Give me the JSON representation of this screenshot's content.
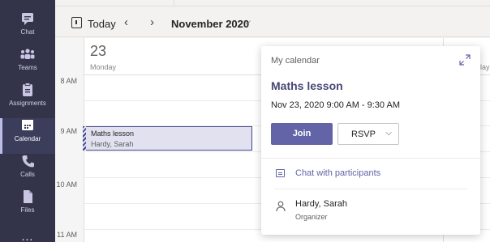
{
  "rail": {
    "items": [
      {
        "label": "Chat",
        "icon": "chat-icon"
      },
      {
        "label": "Teams",
        "icon": "teams-icon"
      },
      {
        "label": "Assignments",
        "icon": "assignments-icon"
      },
      {
        "label": "Calendar",
        "icon": "calendar-icon",
        "active": true
      },
      {
        "label": "Calls",
        "icon": "calls-icon"
      },
      {
        "label": "Files",
        "icon": "files-icon"
      }
    ],
    "more_label": "..."
  },
  "header": {
    "today_label": "Today",
    "prev_glyph": "‹",
    "next_glyph": "›",
    "month_label": "November 2020",
    "month_caret": "⌵"
  },
  "calendar": {
    "day_number": "23",
    "day_name": "Monday",
    "times": [
      "8 AM",
      "9 AM",
      "10 AM",
      "11 AM"
    ],
    "right_peek": "lay"
  },
  "event": {
    "title": "Maths lesson",
    "organizer": "Hardy, Sarah"
  },
  "popup": {
    "calendar_name": "My calendar",
    "title": "Maths lesson",
    "time": "Nov 23, 2020 9:00 AM - 9:30 AM",
    "join_label": "Join",
    "rsvp_label": "RSVP",
    "rsvp_caret": "⌵",
    "chat_label": "Chat with participants",
    "organizer_name": "Hardy, Sarah",
    "organizer_role": "Organizer"
  },
  "colors": {
    "rail_bg": "#33344a",
    "accent": "#6264a7",
    "event_bg": "#e1e1f0"
  }
}
